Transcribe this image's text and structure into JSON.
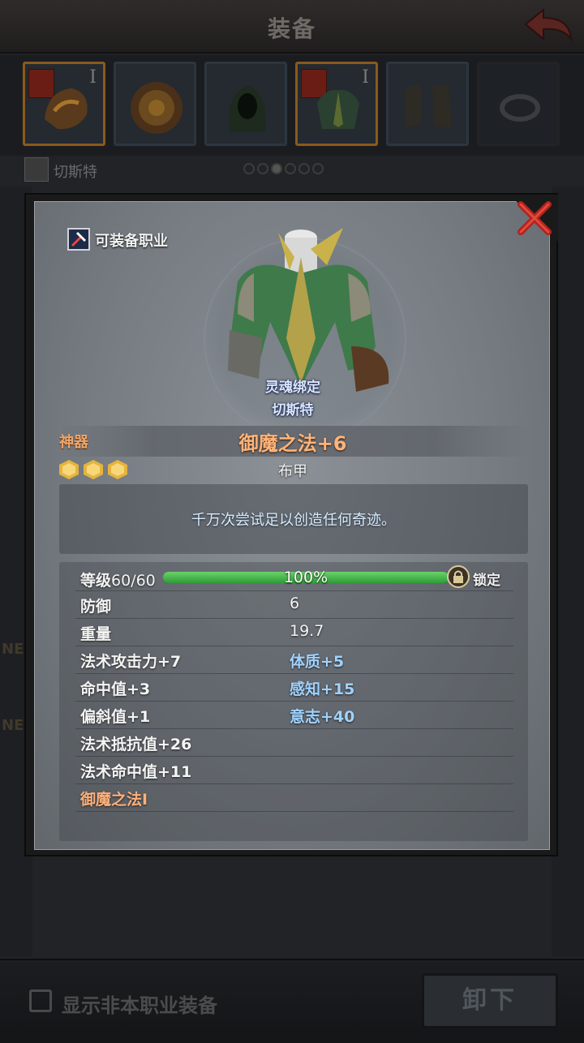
{
  "header": {
    "title": "装备"
  },
  "slots": [
    {
      "name": "dragon-helmet",
      "rank": "I"
    },
    {
      "name": "sun-shield",
      "rank": ""
    },
    {
      "name": "hood-cloak",
      "rank": ""
    },
    {
      "name": "leaf-armor",
      "rank": "I"
    },
    {
      "name": "leather-boots",
      "rank": ""
    },
    {
      "name": "ring",
      "rank": ""
    }
  ],
  "character": {
    "name": "切斯特"
  },
  "pager": {
    "total": 6,
    "current": 3
  },
  "modal": {
    "job_label": "可装备职业",
    "soulbind_label": "灵魂绑定",
    "soulbind_name": "切斯特",
    "rarity": "神器",
    "item_name": "御魔之法+6",
    "item_type": "布甲",
    "star_count": 3,
    "description": "千万次尝试足以创造任何奇迹。",
    "level": {
      "label": "等级",
      "value": "60/60",
      "percent_text": "100%",
      "percent": 100,
      "lock_label": "锁定"
    },
    "stats": [
      {
        "left": "防御",
        "right": "6"
      },
      {
        "left": "重量",
        "right": "19.7"
      },
      {
        "left": "法术攻击力+7",
        "right": "体质+5"
      },
      {
        "left": "命中值+3",
        "right": "感知+15"
      },
      {
        "left": "偏斜值+1",
        "right": "意志+40"
      },
      {
        "left": "法术抵抗值+26",
        "right": ""
      },
      {
        "left": "法术命中值+11",
        "right": ""
      },
      {
        "left": "御魔之法I",
        "right": ""
      }
    ]
  },
  "footer": {
    "checkbox_label": "显示非本职业装备",
    "unequip_label": "卸下"
  },
  "side": {
    "ne_label": "NE"
  },
  "colors": {
    "accent_orange": "#ffb37a",
    "stat_blue": "#9fd2ff",
    "level_green": "#3fb446"
  }
}
